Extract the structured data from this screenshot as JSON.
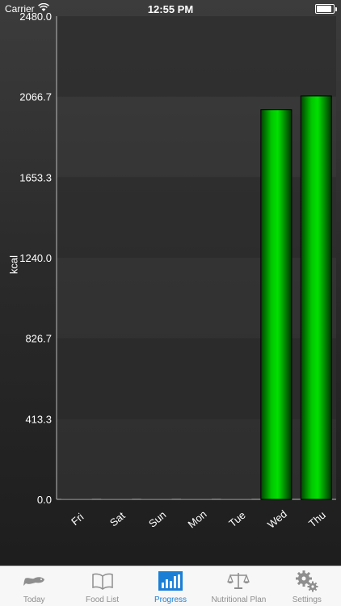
{
  "status_bar": {
    "carrier": "Carrier",
    "time": "12:55 PM",
    "battery_level": 0.9
  },
  "chart_data": {
    "type": "bar",
    "categories": [
      "Fri",
      "Sat",
      "Sun",
      "Mon",
      "Tue",
      "Wed",
      "Thu"
    ],
    "values": [
      0,
      0,
      0,
      0,
      0,
      2000,
      2070
    ],
    "ylabel": "kcal",
    "ylim": [
      0,
      2480
    ],
    "yticks": [
      "0.0",
      "413.3",
      "826.7",
      "1240.0",
      "1653.3",
      "2066.7",
      "2480.0"
    ],
    "bar_color": "#00c800"
  },
  "tab_bar": {
    "active_color": "#1b7fd6",
    "inactive_color": "#8e8e8e",
    "items": [
      {
        "label": "Today",
        "icon": "fish-icon"
      },
      {
        "label": "Food List",
        "icon": "book-icon"
      },
      {
        "label": "Progress",
        "icon": "bar-chart-icon"
      },
      {
        "label": "Nutritional Plan",
        "icon": "scale-icon"
      },
      {
        "label": "Settings",
        "icon": "gears-icon"
      }
    ]
  }
}
